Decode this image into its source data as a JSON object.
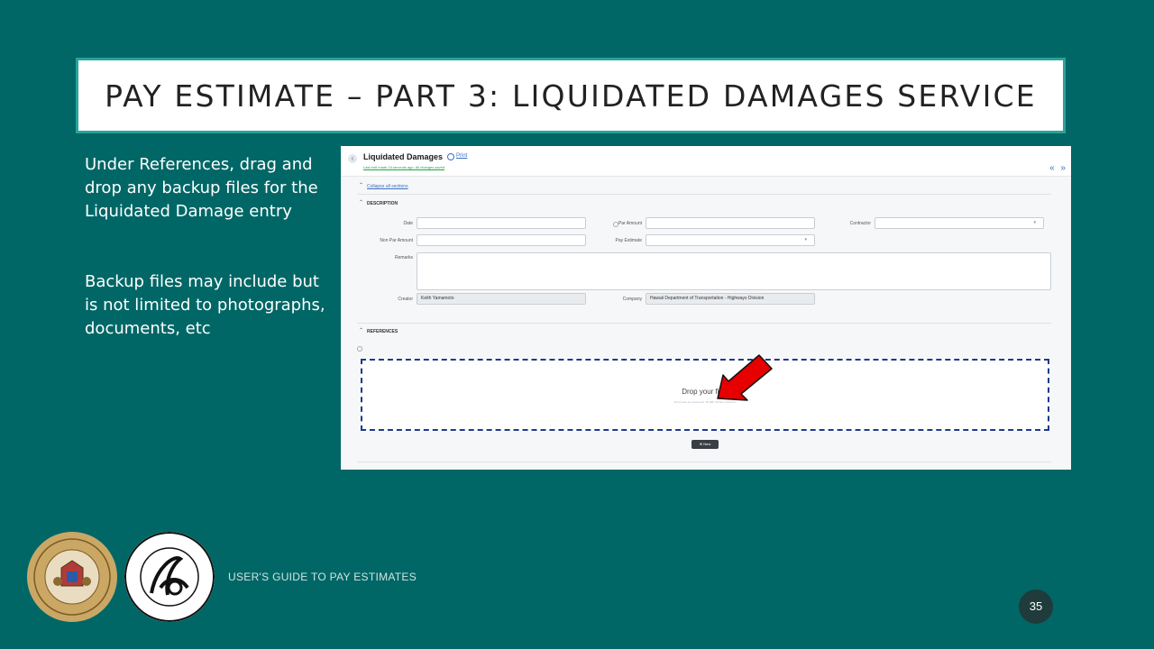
{
  "slide": {
    "title": "PAY ESTIMATE – PART 3: LIQUIDATED DAMAGES SERVICE",
    "instructions": [
      "Under References, drag and drop any backup files for the Liquidated Damage entry",
      "Backup files may include but is not limited to photographs, documents, etc"
    ],
    "footer": "USER'S GUIDE TO PAY ESTIMATES",
    "page_number": "35"
  },
  "app": {
    "back_icon": "‹",
    "page_title": "Liquidated Damages",
    "print_label": "Print",
    "save_status": "Last edit made 24 seconds ago. All changes saved",
    "nav_arrows": "« »",
    "collapse_all_label": "Collapse all sections",
    "description_section": "DESCRIPTION",
    "references_section": "REFERENCES",
    "fields": {
      "date_label": "Date",
      "date_value": "",
      "par_amount_label": "Par Amount",
      "par_amount_value": "",
      "contractor_label": "Contractor",
      "contractor_value": "",
      "non_par_amount_label": "Non Par Amount",
      "non_par_amount_value": "",
      "pay_estimate_label": "Pay Estimate",
      "pay_estimate_value": "",
      "remarks_label": "Remarks",
      "remarks_value": "",
      "creator_label": "Creator",
      "creator_value": "Keith Yamamoto",
      "company_label": "Company",
      "company_value": "Hawaii Department of Transportation - Highways Division"
    },
    "drop_zone_text": "Drop your files",
    "drop_zone_subtext": "All formats are supported. 50 MB, 20 files maximum",
    "new_button_label": "New",
    "new_button_icon": "⊕"
  },
  "colors": {
    "background": "#006766",
    "title_border": "#2aa39a",
    "link_blue": "#3b6fc0",
    "drop_border": "#1d3a8f",
    "arrow_red": "#e60000"
  },
  "icons": {
    "back": "back-arrow-icon",
    "print": "print-icon",
    "caret": "chevron-up-icon",
    "dropdown": "chevron-down-icon",
    "pointer": "red-arrow-pointer"
  }
}
